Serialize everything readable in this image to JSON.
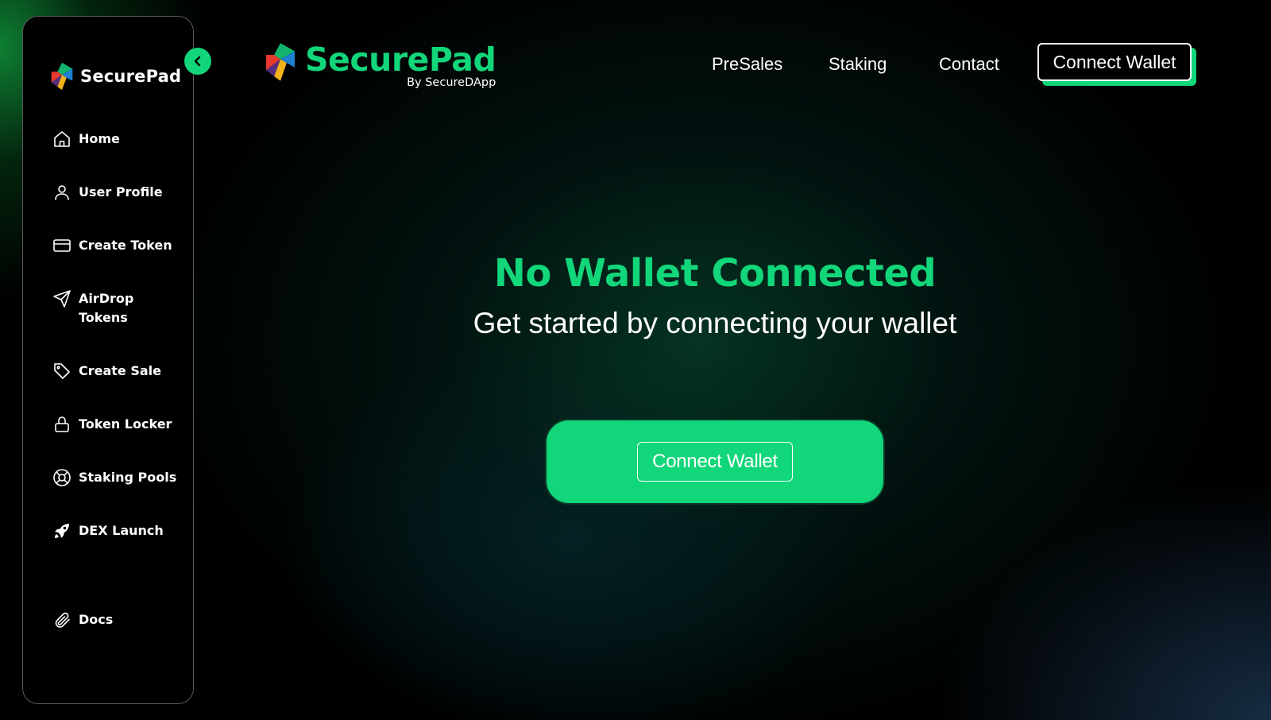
{
  "sidebar": {
    "logo_text": "SecurePad",
    "items": [
      {
        "label": "Home",
        "icon": "home-icon"
      },
      {
        "label": "User Profile",
        "icon": "user-icon"
      },
      {
        "label": "Create Token",
        "icon": "card-icon"
      },
      {
        "label": "AirDrop Tokens",
        "icon": "send-icon"
      },
      {
        "label": "Create Sale",
        "icon": "tag-icon"
      },
      {
        "label": "Token Locker",
        "icon": "lock-icon"
      },
      {
        "label": "Staking Pools",
        "icon": "lifebuoy-icon"
      },
      {
        "label": "DEX Launch",
        "icon": "rocket-icon"
      },
      {
        "label": "Docs",
        "icon": "paperclip-icon"
      }
    ]
  },
  "header": {
    "brand_name": "SecurePad",
    "brand_sub": "By SecureDApp",
    "nav": [
      "PreSales",
      "Staking",
      "Contact"
    ],
    "connect_label": "Connect Wallet"
  },
  "hero": {
    "title": "No Wallet Connected",
    "subtitle": "Get started by connecting your wallet",
    "button_label": "Connect Wallet"
  },
  "colors": {
    "accent": "#12d67a",
    "background": "#000000",
    "text": "#ffffff"
  }
}
